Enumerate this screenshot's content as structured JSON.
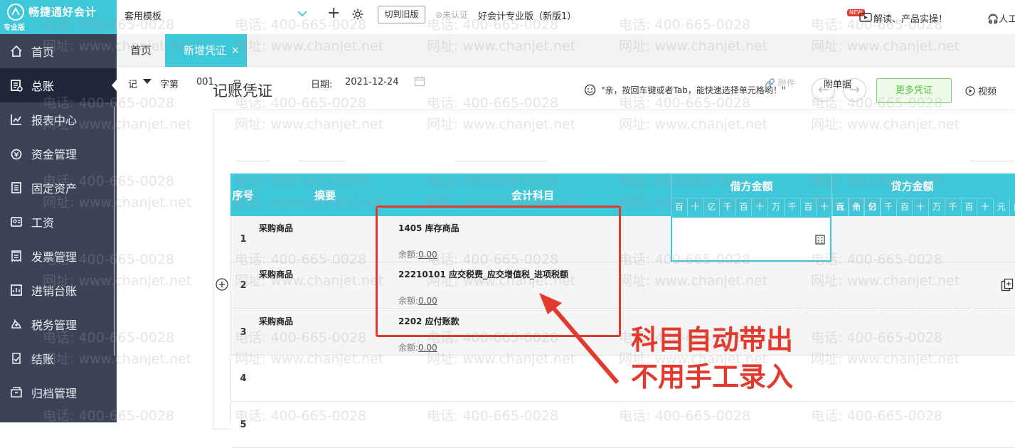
{
  "app": {
    "logo_name": "畅捷通好会计",
    "edition": "专业版"
  },
  "sidebar": {
    "items": [
      {
        "label": "首页",
        "icon": "home-icon"
      },
      {
        "label": "总账",
        "icon": "ledger-icon"
      },
      {
        "label": "报表中心",
        "icon": "chart-icon"
      },
      {
        "label": "资金管理",
        "icon": "money-icon"
      },
      {
        "label": "固定资产",
        "icon": "asset-icon"
      },
      {
        "label": "工资",
        "icon": "salary-icon"
      },
      {
        "label": "发票管理",
        "icon": "invoice-icon"
      },
      {
        "label": "进销台账",
        "icon": "inventory-icon"
      },
      {
        "label": "税务管理",
        "icon": "tax-icon"
      },
      {
        "label": "结账",
        "icon": "closing-icon"
      },
      {
        "label": "归档管理",
        "icon": "archive-icon"
      }
    ]
  },
  "topbar": {
    "template": "套用模板",
    "old_version_button": "切到旧版",
    "cert_status": "未认证",
    "account_name": "好会计专业版（新版1）",
    "news_badge": "NEW",
    "news_text": "解读、产品实操！",
    "service": "人工"
  },
  "tabs": {
    "home": "首页",
    "current": "新增凭证"
  },
  "voucher": {
    "title": "记账凭证",
    "hint": "\"亲，按回车键或者Tab，能快速选择单元格哟！\"",
    "more_button": "更多凭证",
    "video": "视频",
    "type": "记",
    "zi_label": "字第",
    "number": "001",
    "hao_label": "号",
    "date_label": "日期:",
    "date": "2021-12-24",
    "attachment": "附件",
    "docs_label": "附单据"
  },
  "table": {
    "headers": {
      "seq": "序号",
      "summary": "摘要",
      "subject": "会计科目",
      "debit": "借方金额",
      "credit": "贷方金额"
    },
    "digit_units": [
      "百",
      "十",
      "亿",
      "千",
      "百",
      "十",
      "万",
      "千",
      "百",
      "十",
      "元",
      "角",
      "分"
    ],
    "balance_label": "余额:",
    "rows": [
      {
        "no": "1",
        "summary": "采购商品",
        "subject": "1405 库存商品",
        "balance": "0.00"
      },
      {
        "no": "2",
        "summary": "采购商品",
        "subject": "22210101 应交税费_应交增值税_进项税额",
        "balance": "0.00"
      },
      {
        "no": "3",
        "summary": "采购商品",
        "subject": "2202 应付账款",
        "balance": "0.00"
      },
      {
        "no": "4",
        "summary": "",
        "subject": "",
        "balance": ""
      },
      {
        "no": "5",
        "summary": "",
        "subject": "",
        "balance": ""
      }
    ]
  },
  "annotation": {
    "line1": "科目自动带出",
    "line2": "不用手工录入",
    "color": "#e33a2e"
  },
  "watermark": {
    "phone": "电话: 400-665-0028",
    "site": "网址: www.chanjet.net"
  },
  "colors": {
    "accent": "#3ec7d9",
    "sidebar": "#3b4457",
    "sidebar_active": "#20273a",
    "more_green": "#59c245"
  }
}
